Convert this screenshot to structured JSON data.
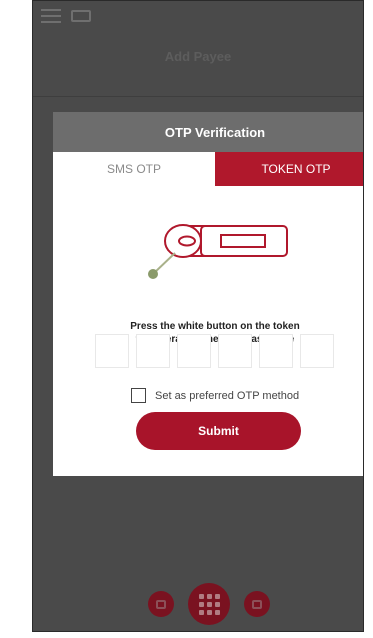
{
  "header": {
    "title": "Add Payee"
  },
  "modal": {
    "title": "OTP Verification",
    "tabs": [
      {
        "label": "SMS OTP",
        "active": false
      },
      {
        "label": "TOKEN OTP",
        "active": true
      }
    ],
    "instruction_line1": "Press the white button on the token",
    "instruction_line2": "to generate a one-time pass code",
    "otp_digits": [
      "",
      "",
      "",
      "",
      "",
      ""
    ],
    "preferred_label": "Set as preferred OTP method",
    "submit_label": "Submit"
  },
  "colors": {
    "brand_red": "#b0182c",
    "overlay": "#4a4a4a",
    "token_accent": "#8a9a6a"
  },
  "icons": [
    "menu-icon",
    "card-icon",
    "token-device-icon",
    "screen-icon",
    "grid-icon",
    "monitor-icon"
  ]
}
